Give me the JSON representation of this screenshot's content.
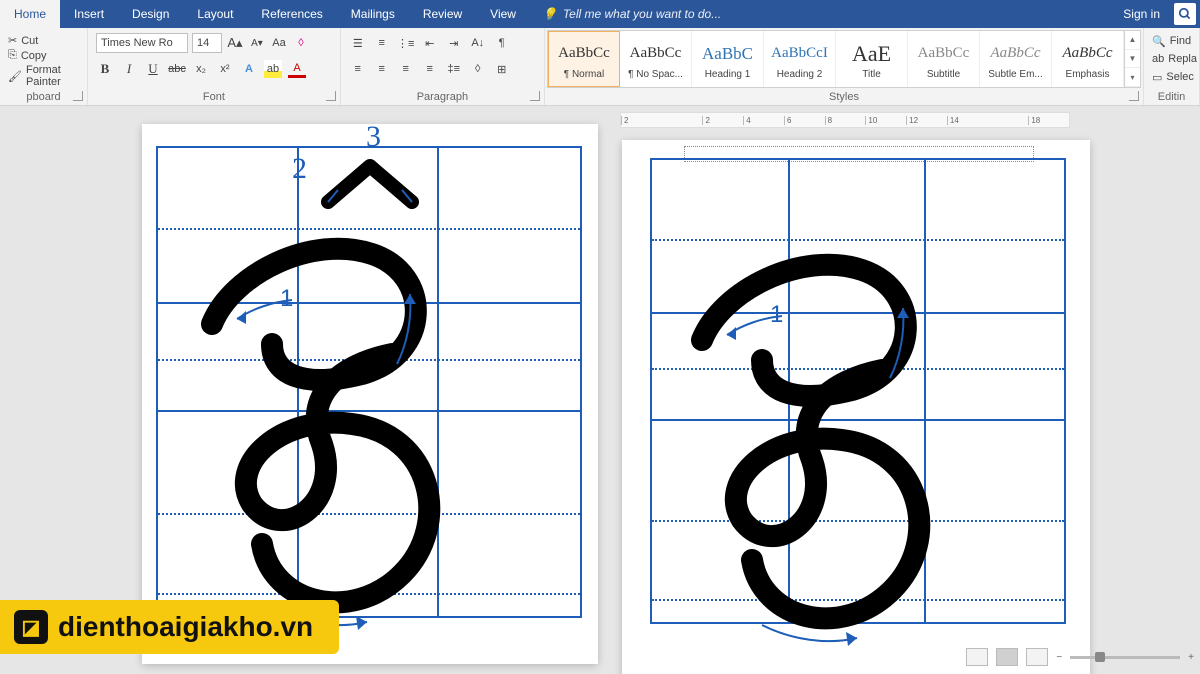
{
  "tabs": {
    "home": "Home",
    "insert": "Insert",
    "design": "Design",
    "layout": "Layout",
    "references": "References",
    "mailings": "Mailings",
    "review": "Review",
    "view": "View",
    "tellme": "Tell me what you want to do...",
    "signin": "Sign in"
  },
  "clipboard": {
    "cut": "Cut",
    "copy": "Copy",
    "painter": "Format Painter",
    "title": "pboard"
  },
  "font": {
    "name": "Times New Ro",
    "size": "14",
    "title": "Font"
  },
  "paragraph": {
    "title": "Paragraph"
  },
  "styles": {
    "title": "Styles",
    "items": [
      {
        "preview": "AaBbCc",
        "label": "¶ Normal"
      },
      {
        "preview": "AaBbCc",
        "label": "¶ No Spac..."
      },
      {
        "preview": "AaBbC",
        "label": "Heading 1"
      },
      {
        "preview": "AaBbCcI",
        "label": "Heading 2"
      },
      {
        "preview": "AaE",
        "label": "Title"
      },
      {
        "preview": "AaBbCc",
        "label": "Subtitle"
      },
      {
        "preview": "AaBbCc",
        "label": "Subtle Em..."
      },
      {
        "preview": "AaBbCc",
        "label": "Emphasis"
      }
    ]
  },
  "editing": {
    "find": "Find",
    "replace": "Repla",
    "select": "Selec",
    "title": "Editin"
  },
  "ruler": [
    "2",
    "",
    "2",
    "4",
    "6",
    "8",
    "10",
    "12",
    "14",
    "",
    "18"
  ],
  "doc": {
    "left": {
      "num2": "2",
      "num3": "3",
      "num1": "1"
    },
    "right": {
      "num1": "1"
    }
  },
  "watermark": "dienthoaigiakho.vn"
}
